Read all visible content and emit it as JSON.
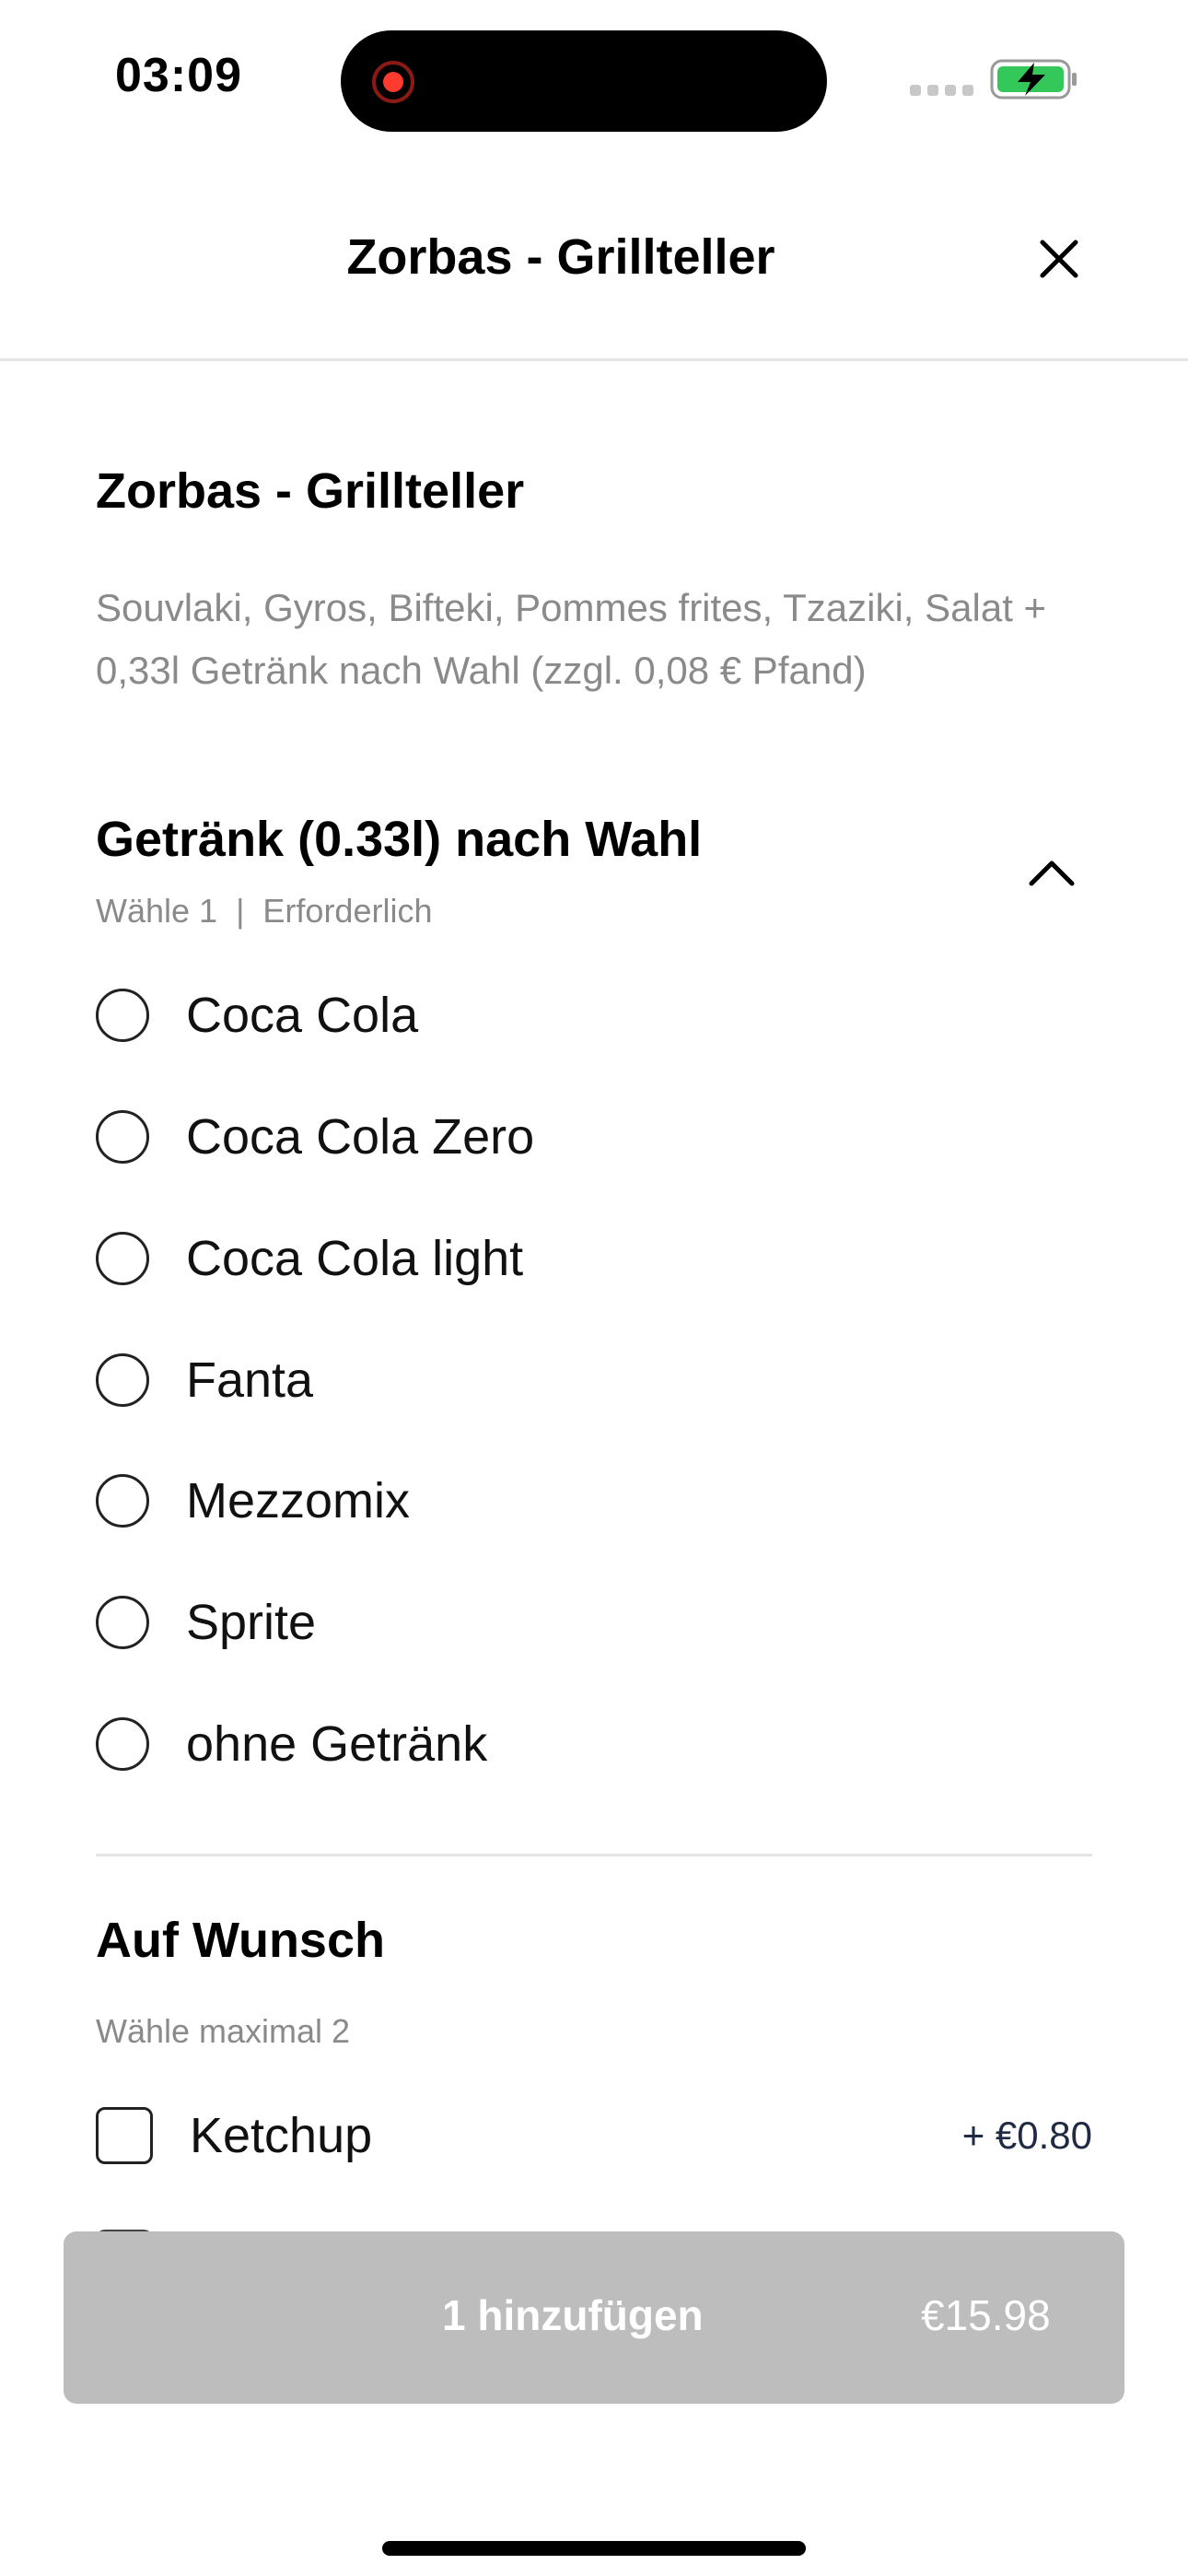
{
  "status_bar": {
    "time": "03:09"
  },
  "header": {
    "title": "Zorbas - Grillteller"
  },
  "product": {
    "name": "Zorbas - Grillteller",
    "description": "Souvlaki, Gyros, Bifteki, Pommes frites, Tzaziki, Salat + 0,33l Getränk nach Wahl (zzgl. 0,08 € Pfand)"
  },
  "drink_section": {
    "title": "Getränk (0.33l) nach Wahl",
    "subtitle": "Wähle 1  |  Erforderlich",
    "options": [
      {
        "label": "Coca Cola"
      },
      {
        "label": "Coca Cola Zero"
      },
      {
        "label": "Coca Cola light"
      },
      {
        "label": "Fanta"
      },
      {
        "label": "Mezzomix"
      },
      {
        "label": "Sprite"
      },
      {
        "label": "ohne Getränk"
      }
    ]
  },
  "extras_section": {
    "title": "Auf Wunsch",
    "subtitle": "Wähle maximal 2",
    "options": [
      {
        "label": "Ketchup",
        "price": "+ €0.80"
      }
    ]
  },
  "add_button": {
    "label": "1 hinzufügen",
    "price": "€15.98"
  },
  "colors": {
    "button_disabled": "#bdbdbd",
    "muted_text": "#8a8a8a",
    "recording_red": "#ff3b30",
    "battery_green": "#34c759"
  }
}
